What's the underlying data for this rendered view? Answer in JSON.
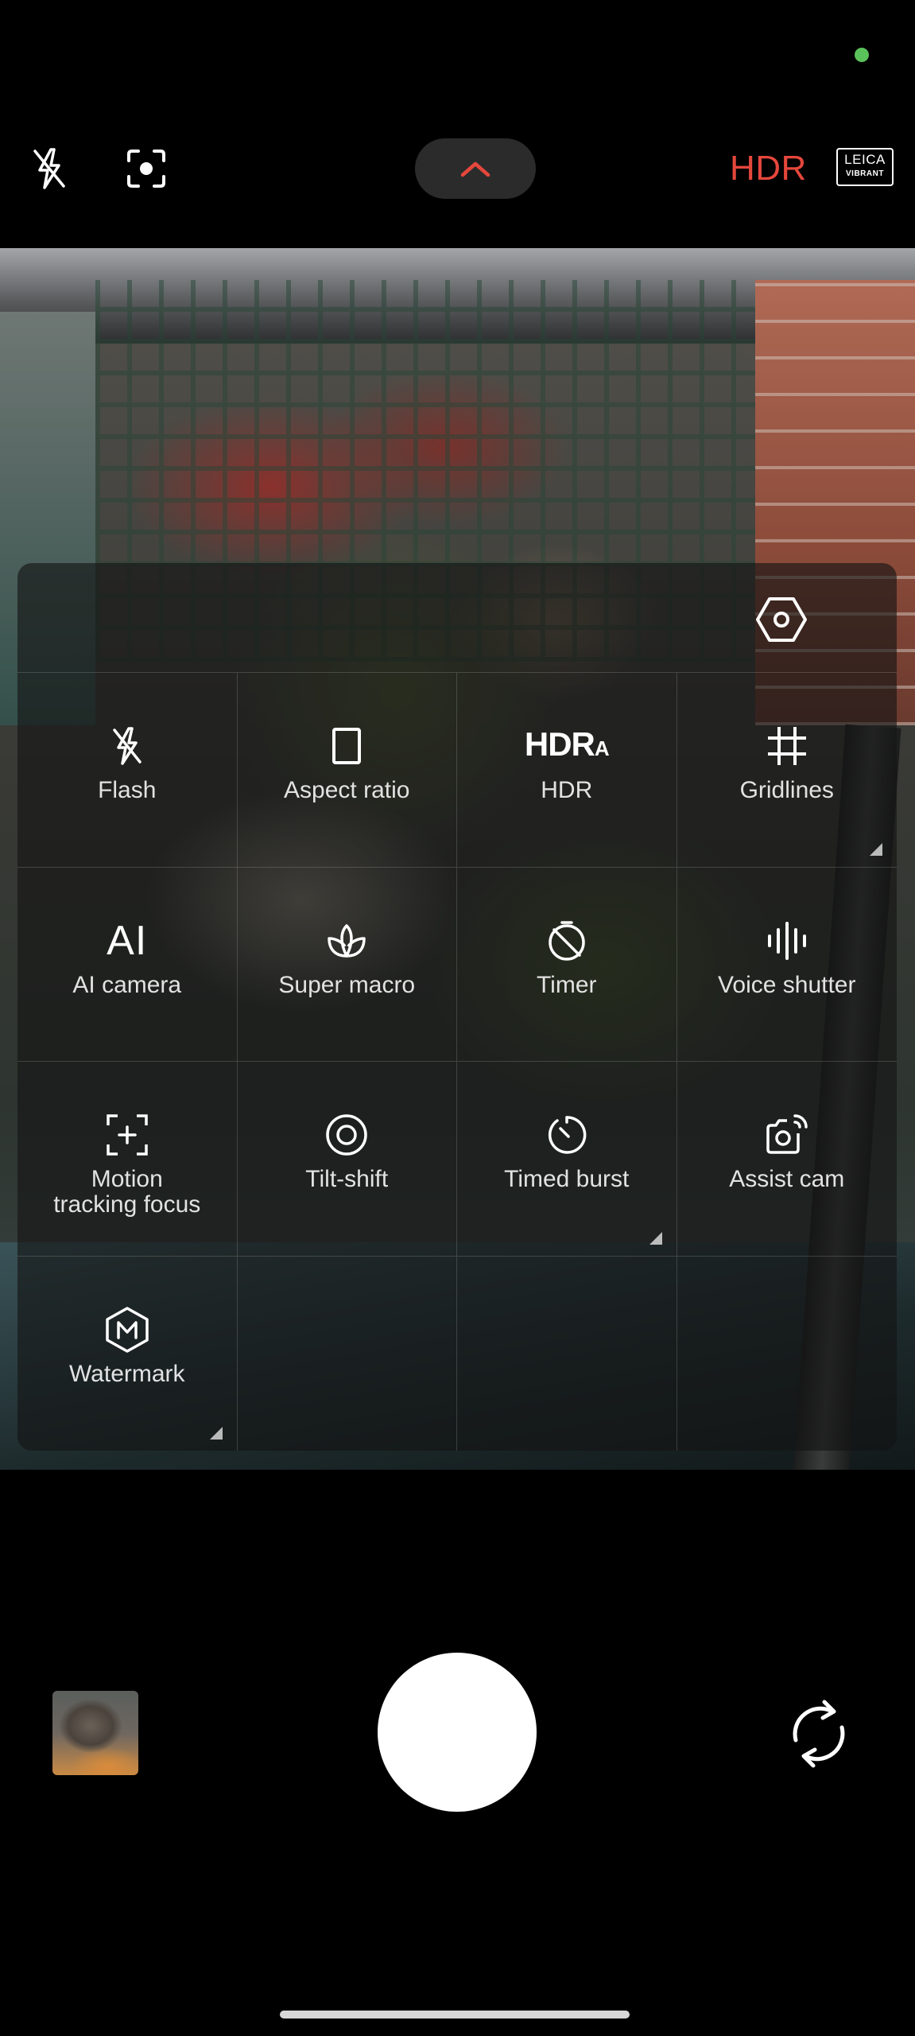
{
  "top_bar": {
    "flash_icon": "flash-off-icon",
    "focus_icon": "focus-frame-icon",
    "expand_icon": "chevron-up-icon",
    "hdr_label": "HDR",
    "hdr_color": "#e5473c",
    "leica_brand": "LEICA",
    "leica_style": "VIBRANT"
  },
  "panel": {
    "settings_icon": "settings-hexagon-icon",
    "tiles": [
      {
        "label": "Flash",
        "icon": "flash-off-icon",
        "has_submenu": false
      },
      {
        "label": "Aspect ratio",
        "icon": "aspect-ratio-icon",
        "has_submenu": false
      },
      {
        "label": "HDR",
        "icon": "hdr-auto-icon",
        "icon_text": "HDR",
        "icon_sub": "A",
        "has_submenu": false
      },
      {
        "label": "Gridlines",
        "icon": "gridlines-icon",
        "has_submenu": true
      },
      {
        "label": "AI camera",
        "icon": "ai-camera-icon",
        "icon_text": "AI",
        "has_submenu": false
      },
      {
        "label": "Super macro",
        "icon": "super-macro-icon",
        "has_submenu": false
      },
      {
        "label": "Timer",
        "icon": "timer-off-icon",
        "has_submenu": false
      },
      {
        "label": "Voice shutter",
        "icon": "voice-shutter-icon",
        "has_submenu": false
      },
      {
        "label_line1": "Motion",
        "label_line2": "tracking focus",
        "icon": "motion-tracking-focus-icon",
        "has_submenu": false
      },
      {
        "label": "Tilt-shift",
        "icon": "tilt-shift-icon",
        "has_submenu": false
      },
      {
        "label": "Timed burst",
        "icon": "timed-burst-icon",
        "has_submenu": true
      },
      {
        "label": "Assist cam",
        "icon": "assist-cam-icon",
        "has_submenu": false
      },
      {
        "label": "Watermark",
        "icon": "watermark-icon",
        "has_submenu": true
      }
    ]
  },
  "bottom": {
    "gallery_thumb": "gallery-thumbnail",
    "shutter": "shutter-button",
    "switch_icon": "switch-camera-icon"
  }
}
